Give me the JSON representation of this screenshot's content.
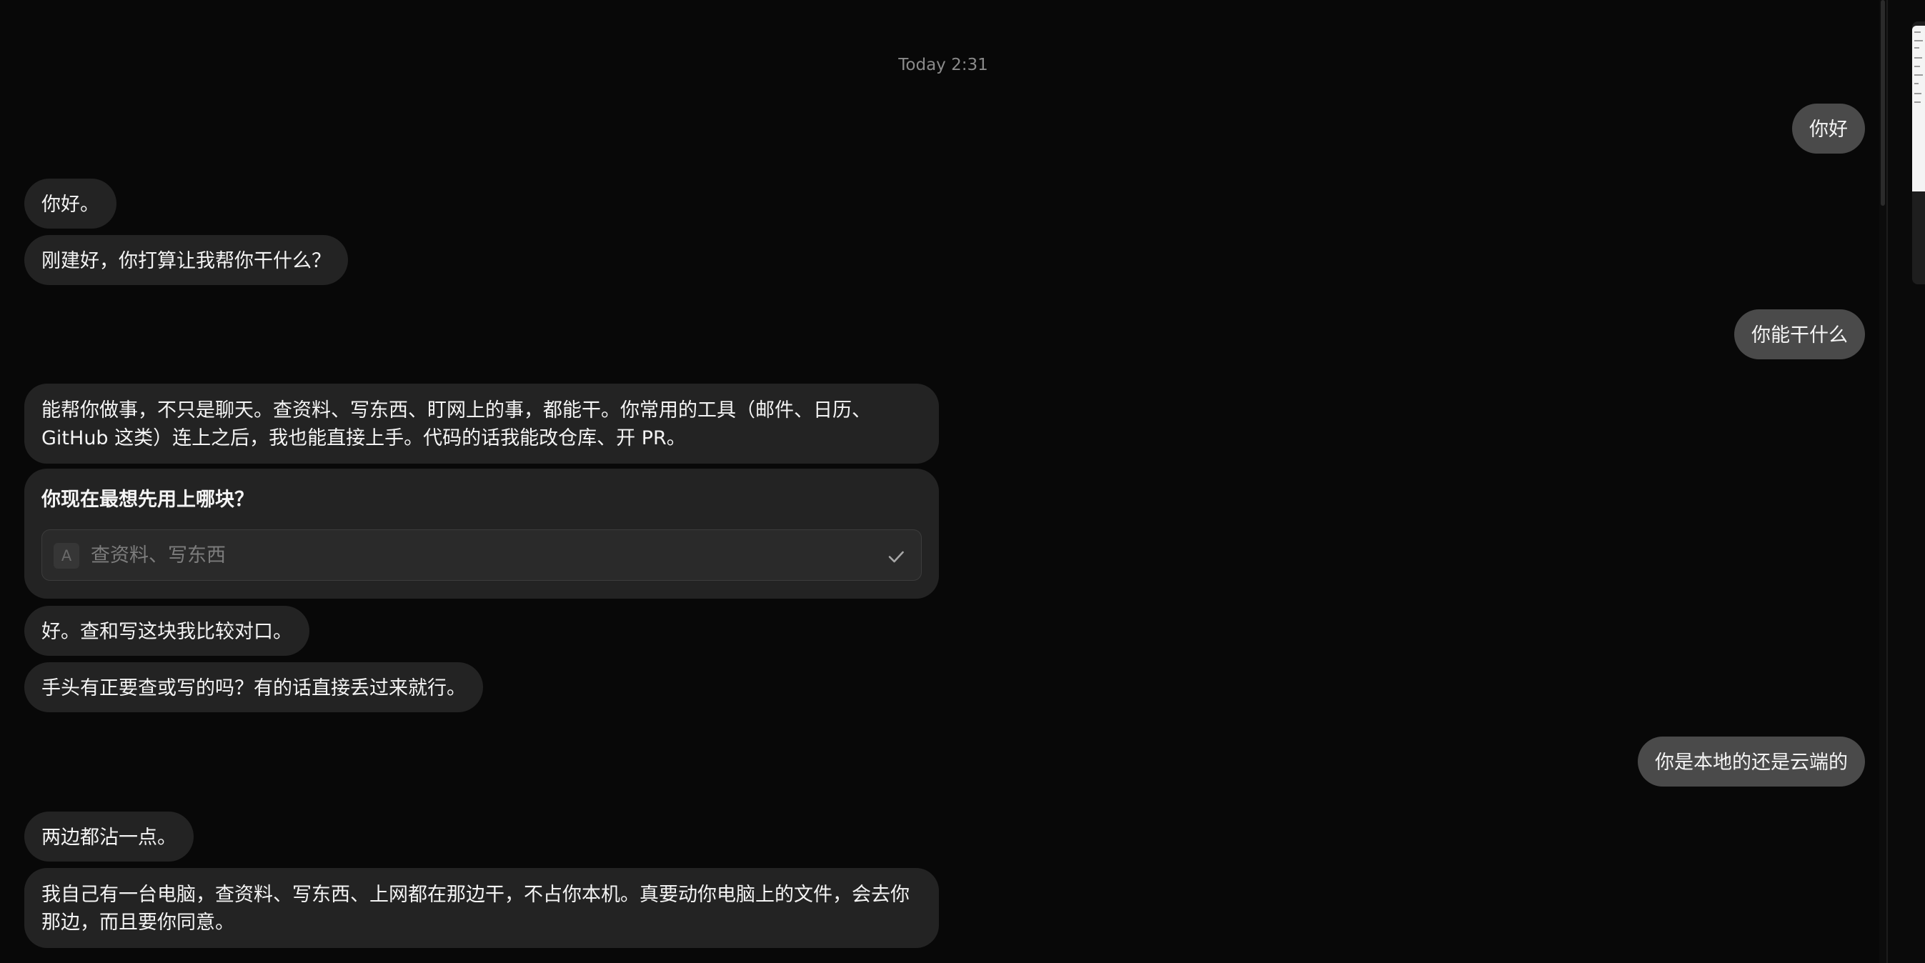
{
  "timestamp": "Today 2:31",
  "messages": {
    "user_1": "你好",
    "bot_1": "你好。",
    "bot_2": "刚建好，你打算让我帮你干什么？",
    "user_2": "你能干什么",
    "bot_3": "能帮你做事，不只是聊天。查资料、写东西、盯网上的事，都能干。你常用的工具（邮件、日历、GitHub 这类）连上之后，我也能直接上手。代码的话我能改仓库、开 PR。",
    "question": {
      "title": "你现在最想先用上哪块？",
      "option_badge": "A",
      "option_label": "查资料、写东西",
      "option_icon": "check-icon"
    },
    "bot_4": "好。查和写这块我比较对口。",
    "bot_5": "手头有正要查或写的吗？有的话直接丢过来就行。",
    "user_3": "你是本地的还是云端的",
    "bot_6": "两边都沾一点。",
    "bot_7": "我自己有一台电脑，查资料、写东西、上网都在那边干，不占你本机。真要动你电脑上的文件，会去你那边，而且要你同意。"
  },
  "colors": {
    "background": "#080808",
    "user_bubble": "#4a4a4a",
    "bot_bubble": "#232323",
    "timestamp_text": "#8a8a8a",
    "option_placeholder_text": "#7c7c7c"
  }
}
